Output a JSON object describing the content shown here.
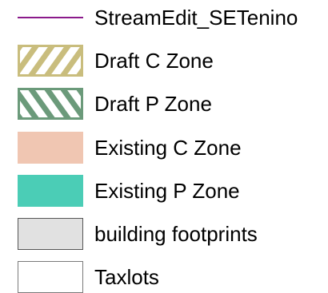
{
  "legend": {
    "items": [
      {
        "label": "StreamEdit_SETenino",
        "symbol": "line",
        "icon": "purple-line",
        "color": "#8b1a8b"
      },
      {
        "label": "Draft C Zone",
        "symbol": "hatch-forward",
        "icon": "tan-diagonal-hatch",
        "color": "#c9bd7d",
        "outline": "#c9bd7d"
      },
      {
        "label": "Draft P Zone",
        "symbol": "hatch-backward",
        "icon": "green-diagonal-hatch",
        "color": "#6b9a7a",
        "outline": "#6b9a7a"
      },
      {
        "label": "Existing C Zone",
        "symbol": "fill",
        "icon": "peach-fill",
        "color": "#f0c6b2"
      },
      {
        "label": "Existing P Zone",
        "symbol": "fill",
        "icon": "teal-fill",
        "color": "#4bcdb6"
      },
      {
        "label": "building footprints",
        "symbol": "fill-outline",
        "icon": "gray-fill",
        "color": "#e1e1e1",
        "outline": "#555555"
      },
      {
        "label": "Taxlots",
        "symbol": "fill-outline",
        "icon": "white-fill",
        "color": "#ffffff",
        "outline": "#7a7a7a"
      }
    ]
  }
}
